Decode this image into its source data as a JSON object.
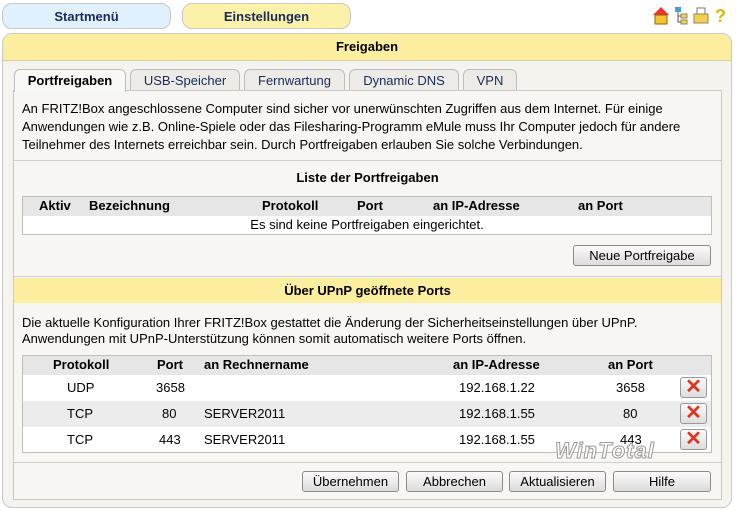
{
  "nav": {
    "start": "Startmenü",
    "settings": "Einstellungen"
  },
  "icons": [
    "home-icon",
    "network-tree-icon",
    "printer-icon",
    "help-icon"
  ],
  "panel": {
    "title": "Freigaben"
  },
  "tabs": [
    {
      "label": "Portfreigaben",
      "active": true
    },
    {
      "label": "USB-Speicher"
    },
    {
      "label": "Fernwartung"
    },
    {
      "label": "Dynamic DNS"
    },
    {
      "label": "VPN"
    }
  ],
  "intro": {
    "line1": "An FRITZ!Box angeschlossene Computer sind sicher vor unerwünschten Zugriffen aus dem Internet. Für einige",
    "line2": "Anwendungen wie z.B. Online-Spiele oder das Filesharing-Programm eMule muss Ihr Computer jedoch für andere",
    "line3": "Teilnehmer des Internets erreichbar sein. Durch Portfreigaben erlauben Sie solche Verbindungen."
  },
  "portlist": {
    "title": "Liste der Portfreigaben",
    "headers": [
      "Aktiv",
      "Bezeichnung",
      "Protokoll",
      "Port",
      "an IP-Adresse",
      "an Port"
    ],
    "empty": "Es sind keine Portfreigaben eingerichtet.",
    "new_button": "Neue Portfreigabe"
  },
  "upnp": {
    "title": "Über UPnP geöffnete Ports",
    "line1": "Die aktuelle Konfiguration Ihrer FRITZ!Box gestattet die Änderung der Sicherheitseinstellungen über UPnP.",
    "line2": "Anwendungen mit UPnP-Unterstützung können somit automatisch weitere Ports öffnen.",
    "headers": [
      "Protokoll",
      "Port",
      "an Rechnername",
      "an IP-Adresse",
      "an Port"
    ],
    "rows": [
      {
        "protocol": "UDP",
        "port": "3658",
        "host": "",
        "ip": "192.168.1.22",
        "to_port": "3658"
      },
      {
        "protocol": "TCP",
        "port": "80",
        "host": "SERVER2011",
        "ip": "192.168.1.55",
        "to_port": "80"
      },
      {
        "protocol": "TCP",
        "port": "443",
        "host": "SERVER2011",
        "ip": "192.168.1.55",
        "to_port": "443"
      }
    ],
    "delete_icon": "x-icon"
  },
  "watermark": "WinTotal",
  "buttons": {
    "apply": "Übernehmen",
    "cancel": "Abbrechen",
    "refresh": "Aktualisieren",
    "help": "Hilfe"
  },
  "colors": {
    "yellow": "#fbee9f",
    "blue": "#dff0fd",
    "delete": "#e5321c"
  }
}
